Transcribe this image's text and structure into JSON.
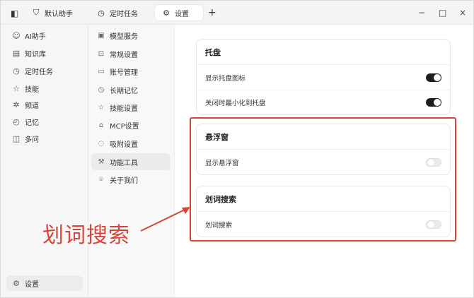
{
  "titlebar": {
    "tabs": [
      {
        "icon": "shield-icon",
        "label": "默认助手"
      },
      {
        "icon": "clock-icon",
        "label": "定时任务"
      },
      {
        "icon": "gear-icon",
        "label": "设置"
      }
    ],
    "add_tab": "+",
    "minimize": "−",
    "maximize": "□",
    "close": "×"
  },
  "sidebar": {
    "items": [
      {
        "icon": "bot-icon",
        "label": "AI助手"
      },
      {
        "icon": "book-icon",
        "label": "知识库"
      },
      {
        "icon": "clock-icon",
        "label": "定时任务"
      },
      {
        "icon": "star-icon",
        "label": "技能"
      },
      {
        "icon": "channel-icon",
        "label": "频道"
      },
      {
        "icon": "memory-icon",
        "label": "记忆"
      },
      {
        "icon": "columns-icon",
        "label": "多问"
      }
    ],
    "settings_label": "设置"
  },
  "subnav": {
    "items": [
      {
        "icon": "cube-icon",
        "label": "模型服务"
      },
      {
        "icon": "settings-icon",
        "label": "常规设置"
      },
      {
        "icon": "id-card-icon",
        "label": "账号管理"
      },
      {
        "icon": "clock-icon",
        "label": "长期记忆"
      },
      {
        "icon": "star-icon",
        "label": "技能设置"
      },
      {
        "icon": "plug-icon",
        "label": "MCP设置"
      },
      {
        "icon": "magnet-icon",
        "label": "吸附设置"
      },
      {
        "icon": "tools-icon",
        "label": "功能工具"
      },
      {
        "icon": "info-icon",
        "label": "关于我们"
      }
    ],
    "active_index": 7
  },
  "content": {
    "tray": {
      "title": "托盘",
      "rows": [
        {
          "label": "显示托盘图标",
          "on": true
        },
        {
          "label": "关闭时最小化到托盘",
          "on": true
        }
      ]
    },
    "floating": {
      "title": "悬浮窗",
      "rows": [
        {
          "label": "显示悬浮窗",
          "on": false
        }
      ]
    },
    "word_search": {
      "title": "划词搜索",
      "rows": [
        {
          "label": "划词搜索",
          "on": false
        }
      ]
    }
  },
  "annotation": {
    "text": "划词搜索",
    "color": "#d6453a"
  }
}
